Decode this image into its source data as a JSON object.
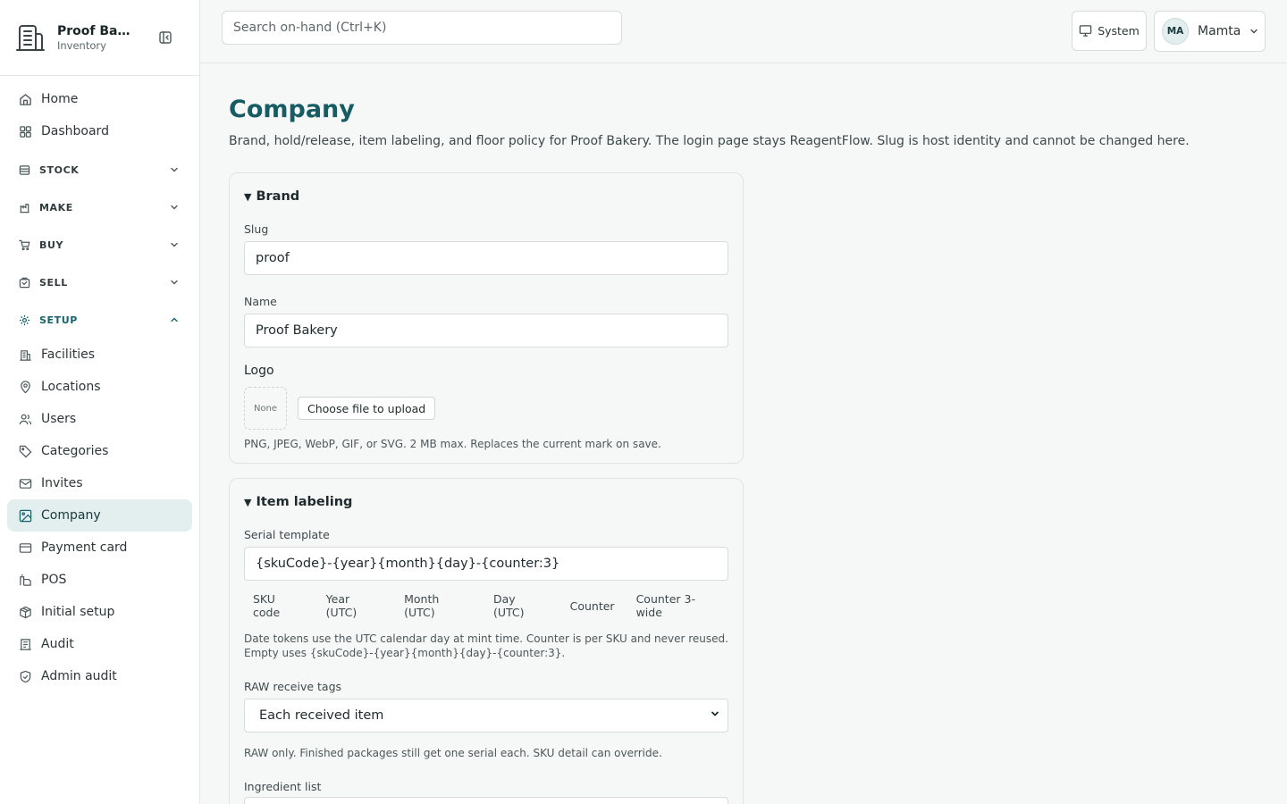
{
  "app": {
    "brand_name": "Proof Bak...",
    "brand_sub": "Inventory"
  },
  "sidebar": {
    "top_items": [
      {
        "label": "Home",
        "icon": "home-icon"
      },
      {
        "label": "Dashboard",
        "icon": "dashboard-icon"
      }
    ],
    "sections": [
      {
        "label": "STOCK",
        "icon": "stock-icon",
        "open": false
      },
      {
        "label": "MAKE",
        "icon": "make-icon",
        "open": false
      },
      {
        "label": "BUY",
        "icon": "cart-icon",
        "open": false
      },
      {
        "label": "SELL",
        "icon": "sell-icon",
        "open": false
      },
      {
        "label": "SETUP",
        "icon": "gear-icon",
        "open": true
      }
    ],
    "setup_items": [
      {
        "label": "Facilities",
        "icon": "building-icon"
      },
      {
        "label": "Locations",
        "icon": "map-pin-icon"
      },
      {
        "label": "Users",
        "icon": "users-icon"
      },
      {
        "label": "Categories",
        "icon": "tag-icon"
      },
      {
        "label": "Invites",
        "icon": "mail-icon"
      },
      {
        "label": "Company",
        "icon": "image-icon",
        "active": true
      },
      {
        "label": "Payment card",
        "icon": "credit-card-icon"
      },
      {
        "label": "POS",
        "icon": "pos-icon"
      },
      {
        "label": "Initial setup",
        "icon": "package-icon"
      },
      {
        "label": "Audit",
        "icon": "audit-icon"
      },
      {
        "label": "Admin audit",
        "icon": "shield-icon"
      }
    ]
  },
  "topbar": {
    "search_placeholder": "Search on-hand (Ctrl+K)",
    "theme_label": "System",
    "user_initials": "MA",
    "user_name": "Mamta"
  },
  "page": {
    "title": "Company",
    "description": "Brand, hold/release, item labeling, and floor policy for Proof Bakery. The login page stays ReagentFlow. Slug is host identity and cannot be changed here."
  },
  "brand_card": {
    "heading": "Brand",
    "slug_label": "Slug",
    "slug_value": "proof",
    "name_label": "Name",
    "name_value": "Proof Bakery",
    "logo_label": "Logo",
    "logo_placeholder": "None",
    "upload_label": "Choose file to upload",
    "logo_hint": "PNG, JPEG, WebP, GIF, or SVG. 2 MB max. Replaces the current mark on save."
  },
  "labeling_card": {
    "heading": "Item labeling",
    "serial_label": "Serial template",
    "serial_value": "{skuCode}-{year}{month}{day}-{counter:3}",
    "tokens": [
      "SKU code",
      "Year (UTC)",
      "Month (UTC)",
      "Day (UTC)",
      "Counter",
      "Counter 3-wide"
    ],
    "serial_hint": "Date tokens use the UTC calendar day at mint time. Counter is per SKU and never reused. Empty uses {skuCode}-{year}{month}{day}-{counter:3}.",
    "raw_label": "RAW receive tags",
    "raw_value": "Each received item",
    "raw_hint": "RAW only. Finished packages still get one serial each. SKU detail can override.",
    "ingredient_label": "Ingredient list"
  }
}
